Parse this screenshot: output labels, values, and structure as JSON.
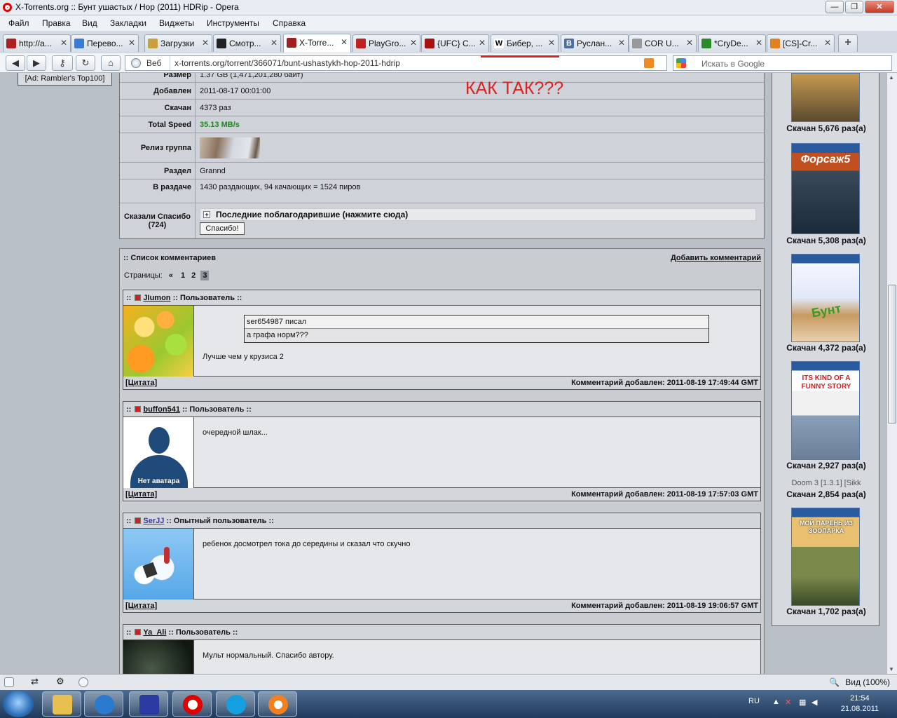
{
  "window": {
    "title": "X-Torrents.org :: Бунт ушастых / Hop (2011) HDRip - Opera",
    "buttons": [
      "—",
      "❐",
      "✕"
    ]
  },
  "menu": [
    "Файл",
    "Правка",
    "Вид",
    "Закладки",
    "Виджеты",
    "Инструменты",
    "Справка"
  ],
  "tabs": [
    {
      "label": "http://a...",
      "color": "#b02020"
    },
    {
      "label": "Перево...",
      "color": "#3a7bd5"
    },
    {
      "label": "Загрузки",
      "color": "#c8a040"
    },
    {
      "label": "Смотр...",
      "color": "#222222"
    },
    {
      "label": "X-Torre...",
      "color": "#a02020",
      "active": true
    },
    {
      "label": "PlayGro...",
      "color": "#c02020"
    },
    {
      "label": "{UFC} C...",
      "color": "#aa1010"
    },
    {
      "label": "Бибер, ...",
      "color": "#ffffff",
      "glyph": "W"
    },
    {
      "label": "Руслан...",
      "color": "#4a6fa5",
      "glyph": "В"
    },
    {
      "label": "COR U...",
      "color": "#999999"
    },
    {
      "label": "*CryDe...",
      "color": "#2a8a2a"
    },
    {
      "label": "[CS]-Cr...",
      "color": "#e08020"
    }
  ],
  "address": {
    "web_label": "Веб",
    "url": "x-torrents.org/torrent/366071/bunt-ushastykh-hop-2011-hdrip",
    "search_placeholder": "Искать в Google"
  },
  "annotation": "КАК ТАК???",
  "left_ad": "[Ad: Rambler's Top100]",
  "info": {
    "size_label": "Размер",
    "size_value": "1.37 GB (1,471,201,280 байт)",
    "added_label": "Добавлен",
    "added_value": "2011-08-17 00:01:00",
    "downloaded_label": "Скачан",
    "downloaded_value": "4373 раз",
    "speed_label": "Total Speed",
    "speed_value": "35.13 MB/s",
    "group_label": "Релиз группа",
    "section_label": "Раздел",
    "section_value": "Grannd",
    "peers_label": "В раздаче",
    "peers_value": "1430 раздающих, 94 качающих = 1524 пиров",
    "thanks_label": "Сказали Спасибо",
    "thanks_count": "(724)",
    "thanks_spoiler": "Последние поблагодарившие (нажмите сюда)",
    "thanks_button": "Спасибо!"
  },
  "comments": {
    "title": ":: Список комментариев",
    "add": "Добавить комментарий",
    "pages_label": "Страницы:",
    "pages_prev": "«",
    "pages": [
      "1",
      "2",
      "3"
    ],
    "items": [
      {
        "user": "JIumon",
        "role": ":: Пользователь ::",
        "quote_author": "ser654987 писал",
        "quote_text": "а графа норм???",
        "text": "Лучше чем у крузиса 2",
        "date": "Комментарий добавлен: 2011-08-19 17:49:44 GMT",
        "quote_link": "[Цитата]"
      },
      {
        "user": "buffon541",
        "role": ":: Пользователь ::",
        "text": "очередной шлак...",
        "avatar_text": "Нет аватара",
        "date": "Комментарий добавлен: 2011-08-19 17:57:03 GMT",
        "quote_link": "[Цитата]"
      },
      {
        "user": "SerJJ",
        "role": ":: Опытный пользователь ::",
        "text": "ребенок досмотрел тока до середины и сказал что скучно",
        "date": "Комментарий добавлен: 2011-08-19 19:06:57 GMT",
        "quote_link": "[Цитата]"
      },
      {
        "user": "Ya_Ali",
        "role": ":: Пользователь ::",
        "text": "Мульт нормальный. Спасибо автору."
      }
    ]
  },
  "sidebar": [
    {
      "caption": "Скачан 5,676 раз(а)",
      "colors": [
        "#5a4a30",
        "#c89a50"
      ]
    },
    {
      "caption": "Скачан 5,308 раз(а)",
      "colors": [
        "#2a4a7a",
        "#c05020"
      ],
      "poster_title": "Форсаж5"
    },
    {
      "caption": "Скачан 4,372 раз(а)",
      "colors": [
        "#e8f0ff",
        "#8a6040"
      ],
      "poster_title": "Бунт"
    },
    {
      "caption": "Скачан 2,927 раз(а)",
      "colors": [
        "#f2f2f2",
        "#3a6a9a"
      ],
      "poster_title": "ITS KIND OF A FUNNY STORY"
    },
    {
      "caption": "Скачан 2,854 раз(а)",
      "alt": "Doom 3 [1.3.1] [Sikk"
    },
    {
      "caption": "Скачан 1,702 раз(а)",
      "colors": [
        "#e0a040",
        "#2a4a20"
      ],
      "poster_title": "МОЙ ПАРЕНЬ ИЗ ЗООПАРКА"
    }
  ],
  "status": {
    "zoom": "Вид (100%)"
  },
  "tray": {
    "lang": "RU",
    "time": "21:54",
    "date": "21.08.2011"
  }
}
